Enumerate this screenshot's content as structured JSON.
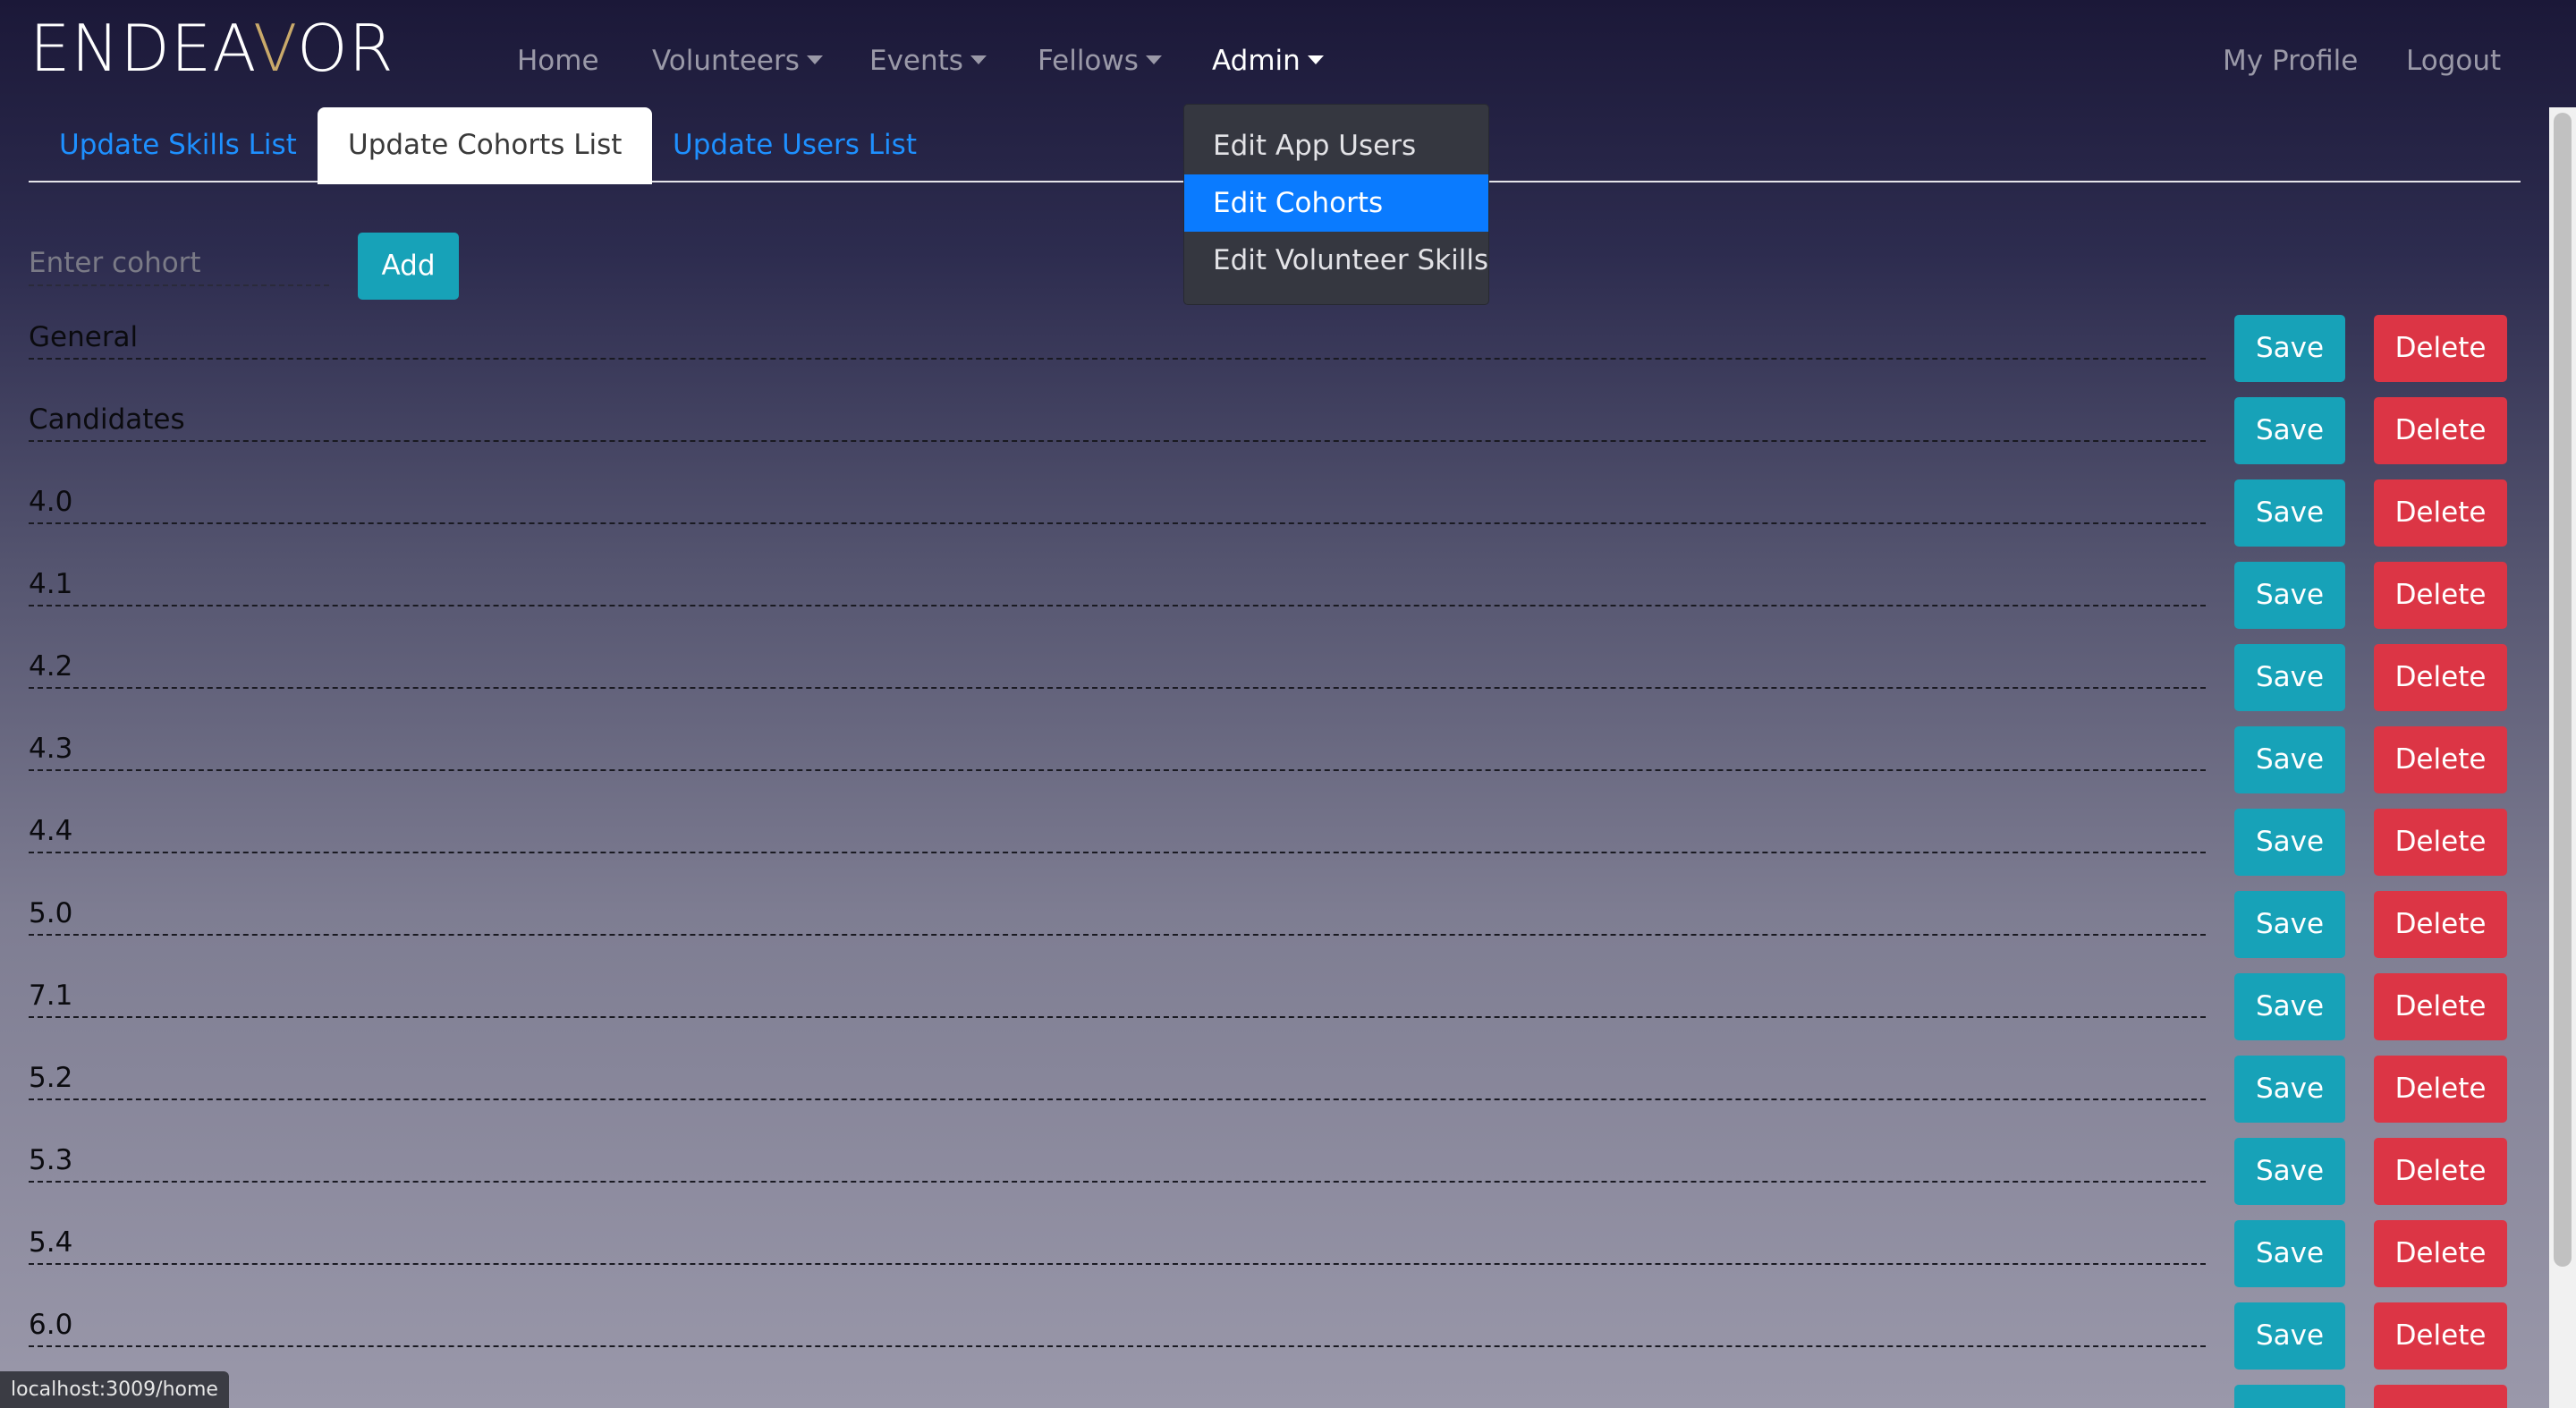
{
  "app": {
    "brand_prefix": "ENDEA",
    "brand_v": "V",
    "brand_suffix": "OR"
  },
  "nav": {
    "home": "Home",
    "volunteers": "Volunteers",
    "events": "Events",
    "fellows": "Fellows",
    "admin": "Admin",
    "my_profile": "My Profile",
    "logout": "Logout"
  },
  "admin_menu": {
    "items": [
      "Edit App Users",
      "Edit Cohorts",
      "Edit Volunteer Skills"
    ],
    "active": "Edit Cohorts"
  },
  "tabs": {
    "skills": "Update Skills List",
    "cohorts": "Update Cohorts List",
    "users": "Update Users List",
    "active": "Update Cohorts List"
  },
  "add_form": {
    "placeholder": "Enter cohort",
    "value": "",
    "add_label": "Add"
  },
  "cohorts": [
    "General",
    "Candidates",
    "4.0",
    "4.1",
    "4.2",
    "4.3",
    "4.4",
    "5.0",
    "7.1",
    "5.2",
    "5.3",
    "5.4",
    "6.0",
    ""
  ],
  "row_actions": {
    "save_label": "Save",
    "delete_label": "Delete"
  },
  "status_bar": {
    "url": "localhost:3009/home"
  },
  "colors": {
    "primary_tab": "#1e90ff",
    "info_button": "#17a2b8",
    "danger_button": "#dc3545",
    "dropdown_active": "#0a7bff",
    "brand_accent": "#c9a96a"
  }
}
